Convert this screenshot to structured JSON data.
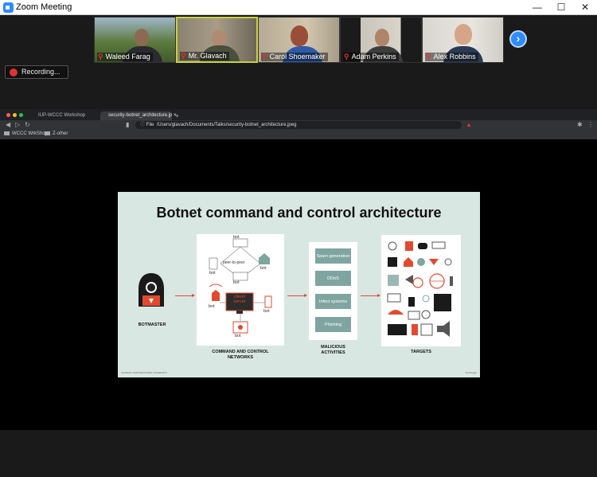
{
  "window": {
    "title": "Zoom Meeting",
    "minimize": "—",
    "maximize": "☐",
    "close": "✕"
  },
  "participants": [
    {
      "name": "Waleed Farag"
    },
    {
      "name": "Mr. Glavach"
    },
    {
      "name": "Carol Shoemaker"
    },
    {
      "name": "Adam Perkins"
    },
    {
      "name": "Alex Robbins"
    }
  ],
  "next_button": "›",
  "recording": {
    "label": "Recording..."
  },
  "browser": {
    "tabs": [
      "IUP-WCCC Workshop",
      "security-botnet_architecture.jp"
    ],
    "new_tab": "+",
    "tab_close": "×",
    "url_prefix": "File",
    "url": "/Users/glavach/Documents/Talks/security-botnet_architecture.jpeg",
    "bookmarks": [
      "WCCC WrkShop",
      "Z-other"
    ]
  },
  "slide": {
    "title": "Botnet command and control architecture",
    "botmaster_label": "BOTMASTER",
    "cc_label_line1": "COMMAND AND CONTROL",
    "cc_label_line2": "NETWORKS",
    "malicious_label_line1": "MALICIOUS",
    "malicious_label_line2": "ACTIVITIES",
    "targets_label": "TARGETS",
    "p2p_label": "peer-to-peer",
    "cs_label_line1": "client/",
    "cs_label_line2": "server",
    "bot_label": "bot",
    "activities": [
      "Spam generation",
      "DDoS",
      "Infect systems",
      "Phishing"
    ],
    "footer_left": "SOURCE: NORTHEASTERN UNIVERSITY",
    "footer_right": "TechTarget"
  },
  "colors": {
    "accent": "#e24a2f",
    "teal": "#7fa5a0",
    "slide_bg": "#d9e7e3",
    "zoom_blue": "#2d8cff"
  }
}
